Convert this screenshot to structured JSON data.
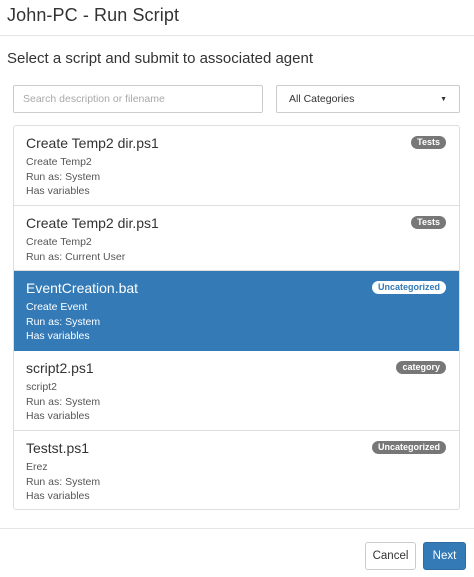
{
  "dialog": {
    "title": "John-PC - Run Script",
    "subtitle": "Select a script and submit to associated agent"
  },
  "search": {
    "placeholder": "Search description or filename",
    "value": ""
  },
  "category_select": {
    "selected": "All Categories",
    "caret": "▼"
  },
  "scripts": [
    {
      "name": "Create Temp2 dir.ps1",
      "badge": "Tests",
      "lines": [
        "Create Temp2",
        "Run as: System",
        "Has variables"
      ],
      "selected": false
    },
    {
      "name": "Create Temp2 dir.ps1",
      "badge": "Tests",
      "lines": [
        "Create Temp2",
        "Run as: Current User"
      ],
      "selected": false
    },
    {
      "name": "EventCreation.bat",
      "badge": "Uncategorized",
      "lines": [
        "Create Event",
        "Run as: System",
        "Has variables"
      ],
      "selected": true
    },
    {
      "name": "script2.ps1",
      "badge": "category",
      "lines": [
        "script2",
        "Run as: System",
        "Has variables"
      ],
      "selected": false
    },
    {
      "name": "Testst.ps1",
      "badge": "Uncategorized",
      "lines": [
        "Erez",
        "Run as: System",
        "Has variables"
      ],
      "selected": false
    }
  ],
  "footer": {
    "cancel_label": "Cancel",
    "next_label": "Next"
  },
  "colors": {
    "primary": "#337ab7",
    "badge": "#777777",
    "border": "#dddddd"
  }
}
